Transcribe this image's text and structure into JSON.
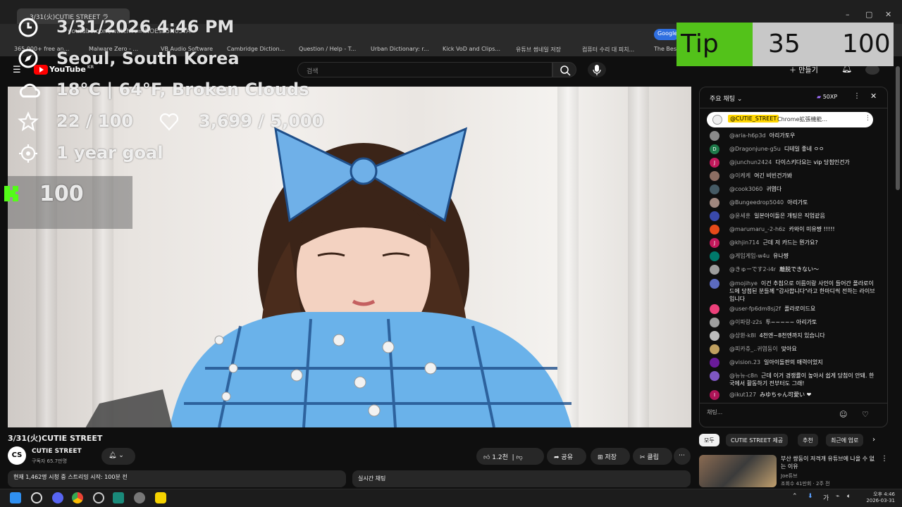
{
  "browser": {
    "tab_title": "3/31(火)CUTIE STREET ラ",
    "url": "youtube.com/watch?v=INOEsE5N05YA",
    "google_label": "Google",
    "bookmarks": [
      "365 000+ free an...",
      "Malware Zero - ...",
      "VB Audio Software",
      "Cambridge Diction...",
      "Question / Help - T...",
      "Urban Dictionary: r...",
      "Kick VoD and Clips...",
      "유튜브 썸네일 저장",
      "컴퓨터 수리 대 피치...",
      "The Best"
    ]
  },
  "youtube": {
    "brand": "YouTube",
    "brand_sup": "KR",
    "search_placeholder": "검색",
    "create_label": "만들기",
    "search_icon": "search-icon",
    "mic_icon": "mic-icon",
    "bell_icon": "bell-icon"
  },
  "overlay": {
    "datetime": "3/31/2026 4:46 PM",
    "location": "Seoul, South Korea",
    "weather": "18°C | 64°F, Broken Clouds",
    "stars_count": "22 / 100",
    "hearts_count": "3,699 / 5,000",
    "goal_label": "1 year goal",
    "kick_value": "100",
    "tip_label": "Tip",
    "tip_current": "35",
    "tip_goal": "100",
    "icons": [
      "clock-icon",
      "compass-icon",
      "cloud-icon",
      "star-icon",
      "heart-icon",
      "target-icon"
    ],
    "colors": {
      "kick_green": "#53fc18",
      "tip_green": "#53c21a"
    }
  },
  "chat": {
    "header": "주요 채팅",
    "xp_badge": "50XP",
    "pinned_author": "@CUTIE_STREET",
    "pinned_text": "Chrome拡張機能...",
    "messages": [
      {
        "author": "@aria-h6p3d",
        "text": "아리가토우",
        "color": "#8a8a8a",
        "initial": ""
      },
      {
        "author": "@Dragonjune-g5u",
        "text": "디테일 좋네 ㅇㅇ",
        "color": "#1e7a4a",
        "initial": "D"
      },
      {
        "author": "@junchun2424",
        "text": "다이스키다요는 vip 당첨인건가",
        "color": "#c2185b",
        "initial": "J"
      },
      {
        "author": "@이케케",
        "text": "여긴 비빈건가봐",
        "color": "#8d6e63",
        "initial": ""
      },
      {
        "author": "@cook3060",
        "text": "귀엽다",
        "color": "#455a64",
        "initial": ""
      },
      {
        "author": "@Bungeedrop5040",
        "text": "아리가토",
        "color": "#a1887f",
        "initial": ""
      },
      {
        "author": "@윤세훈",
        "text": "일본아이돌은 개팅은 직업같음",
        "color": "#3949ab",
        "initial": ""
      },
      {
        "author": "@marumaru_-2-h6z",
        "text": "카와이 미유쨩 !!!!!",
        "color": "#e64a19",
        "initial": ""
      },
      {
        "author": "@khjin714",
        "text": "근데 저 카드는 뭔가요?",
        "color": "#c2185b",
        "initial": "J"
      },
      {
        "author": "@게임게임-w4u",
        "text": "유나쨩",
        "color": "#00796b",
        "initial": ""
      },
      {
        "author": "@きゅーです2-i4r",
        "text": "離脱できない〜",
        "color": "#9e9e9e",
        "initial": ""
      },
      {
        "author": "@mojihye",
        "text": "이건 추첨으로 이름이랑 사인이 들어간 폴라로이드에 당첨된 분들께 \"감사합니다\"라고 한마디씩 전하는 라이브입니다",
        "color": "#5c6bc0",
        "initial": ""
      },
      {
        "author": "@user-fp6dm8sj2f",
        "text": "폴라로이드요",
        "color": "#ec407a",
        "initial": ""
      },
      {
        "author": "@이파랑-z2s",
        "text": "투~~~~~ 아리가토",
        "color": "#9e9e9e",
        "initial": ""
      },
      {
        "author": "@상환-k8l",
        "text": "4천엔~8천엔까지 있습니다",
        "color": "#bdbdbd",
        "initial": ""
      },
      {
        "author": "@피카츄_..귀염둥이",
        "text": "맞아요",
        "color": "#c0a060",
        "initial": ""
      },
      {
        "author": "@vision.23",
        "text": "일아이돌판의 매력이었지",
        "color": "#6a1b9a",
        "initial": ""
      },
      {
        "author": "@뉴뉴-c8n",
        "text": "근데 이거 경쟁률이 높아서 쉽게 당첨이 안돼. 한국에서 활동하기 전부터도 그래!",
        "color": "#7e57c2",
        "initial": ""
      },
      {
        "author": "@ikut127",
        "text": "みゆちゃん可愛い ❤",
        "color": "#ad1457",
        "initial": "I"
      }
    ],
    "input_placeholder": "채팅..."
  },
  "video_meta": {
    "title": "3/31(火)CUTIE STREET",
    "channel": "CUTIE STREET",
    "subscribers": "구독자 65.7만명",
    "like_count": "1.2천",
    "share_label": "공유",
    "save_label": "저장",
    "clip_label": "클립",
    "description": "현재 1,462명 시청 중 스트리밍 시작: 100분 전",
    "live_chat_label": "실시간 채팅"
  },
  "sidebar_recs": {
    "chips": [
      "모두",
      "CUTIE STREET 제공",
      "추천",
      "최근에 업로"
    ],
    "rec_title": "부산 쌍둥이 저격개 유튜브에 나올 수 없는 이유",
    "rec_channel": "Joe튜브",
    "rec_meta": "조회수 41만회 · 2주 전"
  },
  "taskbar": {
    "time": "오후 4:46",
    "date": "2026-03-31",
    "ime": "가"
  }
}
